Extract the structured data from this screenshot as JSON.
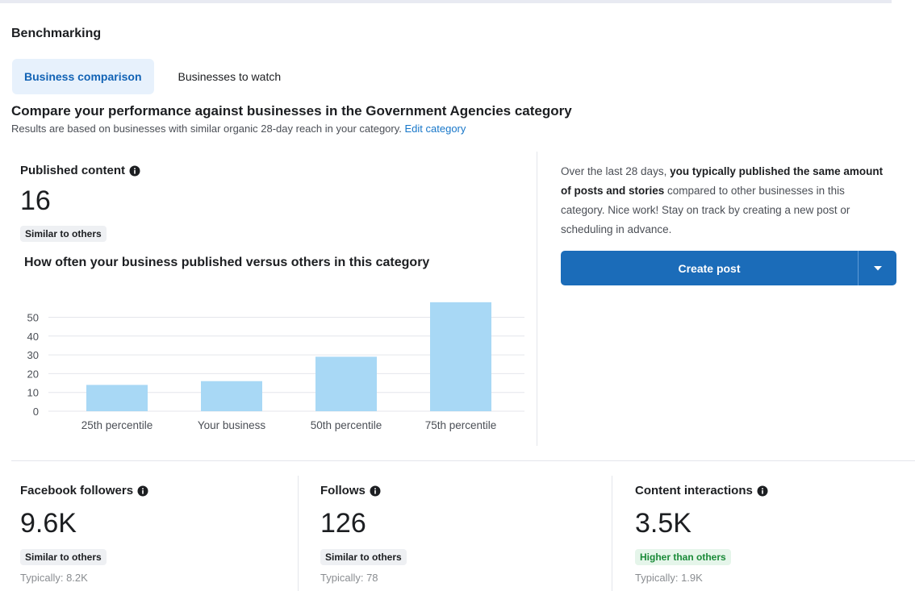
{
  "section_title": "Benchmarking",
  "tabs": [
    {
      "label": "Business comparison",
      "active": true
    },
    {
      "label": "Businesses to watch",
      "active": false
    }
  ],
  "headline": "Compare your performance against businesses in the Government Agencies category",
  "subline": {
    "text": "Results are based on businesses with similar organic 28-day reach in your category.",
    "link": "Edit category"
  },
  "published": {
    "label": "Published content",
    "value": "16",
    "badge": "Similar to others",
    "info_icon": "info-icon"
  },
  "chart_title": "How often your business published versus others in this category",
  "chart_data": {
    "type": "bar",
    "categories": [
      "25th percentile",
      "Your business",
      "50th percentile",
      "75th percentile"
    ],
    "values": [
      14,
      16,
      29,
      58
    ],
    "y_ticks": [
      0,
      10,
      20,
      30,
      40,
      50
    ],
    "ylim": [
      0,
      58
    ],
    "bar_color": "#a8d8f5",
    "grid": true
  },
  "summary": {
    "part1": "Over the last 28 days, ",
    "bold": "you typically published the same amount of posts and stories",
    "part2": " compared to other businesses in this category. Nice work! Stay on track by creating a new post or scheduling in advance."
  },
  "create_button": {
    "label": "Create post",
    "dropdown_icon": "caret-down-icon"
  },
  "metrics": [
    {
      "label": "Facebook followers",
      "value": "9.6K",
      "badge": "Similar to others",
      "badge_type": "neutral",
      "typical": "Typically: 8.2K"
    },
    {
      "label": "Follows",
      "value": "126",
      "badge": "Similar to others",
      "badge_type": "neutral",
      "typical": "Typically: 78"
    },
    {
      "label": "Content interactions",
      "value": "3.5K",
      "badge": "Higher than others",
      "badge_type": "positive",
      "typical": "Typically: 1.9K"
    }
  ],
  "colors": {
    "accent": "#1b6cb9",
    "tab_active_bg": "#e7f1fc",
    "positive": "#1a8a38"
  }
}
